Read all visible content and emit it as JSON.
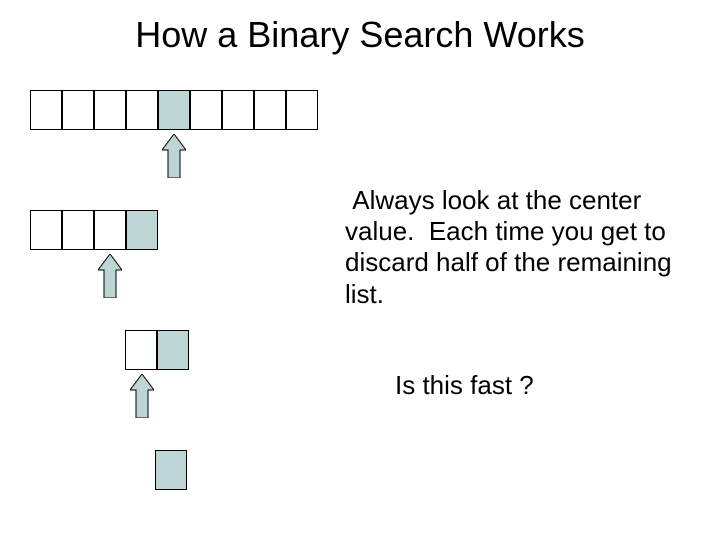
{
  "title": "How a Binary Search Works",
  "explanation": " Always look at the center value.  Each time you get to discard half of the remaining list.",
  "question": "Is this fast ?",
  "rows": [
    {
      "cells": 9,
      "highlight_index": 4
    },
    {
      "cells": 4,
      "highlight_index": 3
    },
    {
      "cells": 2,
      "highlight_index": 1
    },
    {
      "cells": 1,
      "highlight_index": 0
    }
  ],
  "colors": {
    "highlight": "#bed5d5",
    "arrow_fill": "#bed5d5",
    "arrow_stroke": "#000000"
  }
}
